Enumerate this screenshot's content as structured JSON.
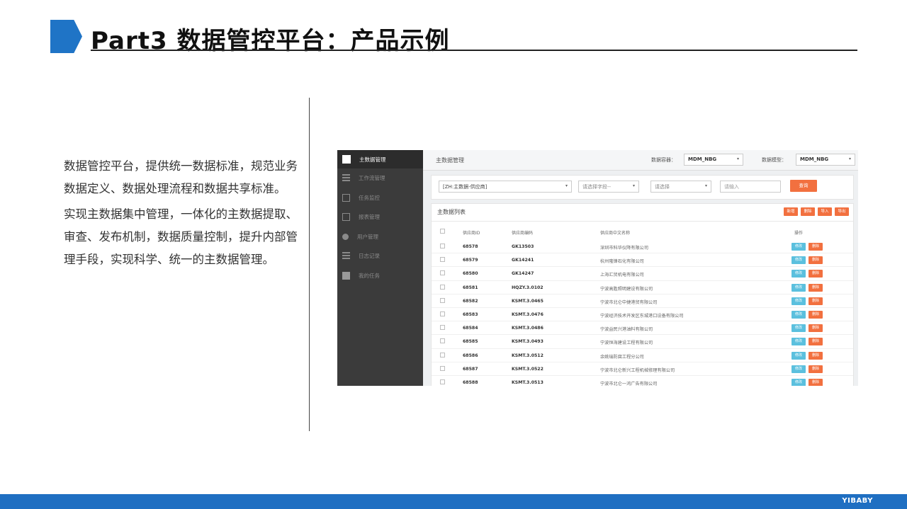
{
  "slide": {
    "title": "Part3 数据管控平台：产品示例",
    "paragraphs": [
      "数据管控平台，提供统一数据标准，规范业务数据定义、数据处理流程和数据共享标准。",
      "实现主数据集中管理，一体化的主数据提取、 审查、发布机制，数据质量控制，提升内部管理手段，实现科学、统一的主数据管理。"
    ],
    "brand": "YIBABY",
    "accent_color": "#1f74c6"
  },
  "app": {
    "sidebar": {
      "items": [
        {
          "label": "主数据管理",
          "icon": "chart-icon",
          "active": true
        },
        {
          "label": "工作流管理",
          "icon": "workflow-icon",
          "active": false
        },
        {
          "label": "任务监控",
          "icon": "monitor-icon",
          "active": false
        },
        {
          "label": "报表管理",
          "icon": "report-icon",
          "active": false
        },
        {
          "label": "用户管理",
          "icon": "user-icon",
          "active": false
        },
        {
          "label": "日志记录",
          "icon": "log-icon",
          "active": false
        },
        {
          "label": "我的任务",
          "icon": "task-icon",
          "active": false
        }
      ]
    },
    "topbar": {
      "breadcrumb": "主数据管理",
      "container_label": "数据容器：",
      "container_value": "MDM_NBG",
      "model_label": "数据模型：",
      "model_value": "MDM_NBG"
    },
    "filters": {
      "entity_value": "[ZH:主数据-供应商]",
      "field_placeholder": "请选择字段--",
      "operator_placeholder": "请选择",
      "input_placeholder": "请输入",
      "query_label": "查询"
    },
    "list": {
      "title": "主数据列表",
      "actions": [
        "新增",
        "删除",
        "导入",
        "导出"
      ],
      "columns": [
        "供应商ID",
        "供应商编码",
        "供应商中文名称",
        "操作"
      ],
      "edit_label": "修改",
      "delete_label": "删除",
      "rows": [
        {
          "id": "68578",
          "code": "GK13503",
          "name": "深圳市科华仪降有限公司"
        },
        {
          "id": "68579",
          "code": "GK14241",
          "name": "杭州隆锋石化有限公司"
        },
        {
          "id": "68580",
          "code": "GK14247",
          "name": "上海汇贸机电有限公司"
        },
        {
          "id": "68581",
          "code": "HQZY.3.0102",
          "name": "宁波高胜照明建设有限公司"
        },
        {
          "id": "68582",
          "code": "KSMT.3.0465",
          "name": "宁波市北仑中捷港贸有限公司"
        },
        {
          "id": "68583",
          "code": "KSMT.3.0476",
          "name": "宁波经济技术开发区东城港口设备有限公司"
        },
        {
          "id": "68584",
          "code": "KSMT.3.0486",
          "name": "宁波益民兴港油料有限公司"
        },
        {
          "id": "68585",
          "code": "KSMT.3.0493",
          "name": "宁波恒海建设工程有限公司"
        },
        {
          "id": "68586",
          "code": "KSMT.3.0512",
          "name": "余姚瑞防腐工程分公司"
        },
        {
          "id": "68587",
          "code": "KSMT.3.0522",
          "name": "宁波市北仑新兴工程机械修理有限公司"
        },
        {
          "id": "68588",
          "code": "KSMT.3.0513",
          "name": "宁波市北仑一鸿广告有限公司"
        }
      ]
    }
  }
}
